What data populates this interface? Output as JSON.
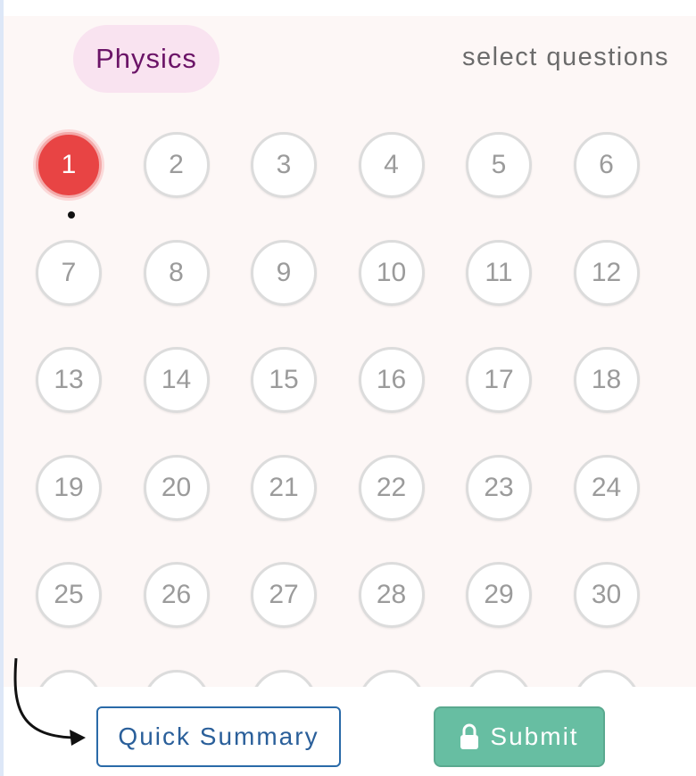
{
  "header": {
    "subject": "Physics",
    "select_label": "select questions"
  },
  "questions": {
    "current": 1,
    "items": [
      "1",
      "2",
      "3",
      "4",
      "5",
      "6",
      "7",
      "8",
      "9",
      "10",
      "11",
      "12",
      "13",
      "14",
      "15",
      "16",
      "17",
      "18",
      "19",
      "20",
      "21",
      "22",
      "23",
      "24",
      "25",
      "26",
      "27",
      "28",
      "29",
      "30"
    ],
    "partially_visible_row_count": 6
  },
  "footer": {
    "quick_summary_label": "Quick Summary",
    "submit_label": "Submit",
    "submit_icon": "lock-icon"
  },
  "colors": {
    "current_question": "#e84444",
    "subject_chip_bg": "#f9e3f0",
    "subject_chip_text": "#6b1467",
    "submit_bg": "#67bea2",
    "quick_summary_border": "#2a6aa8"
  }
}
